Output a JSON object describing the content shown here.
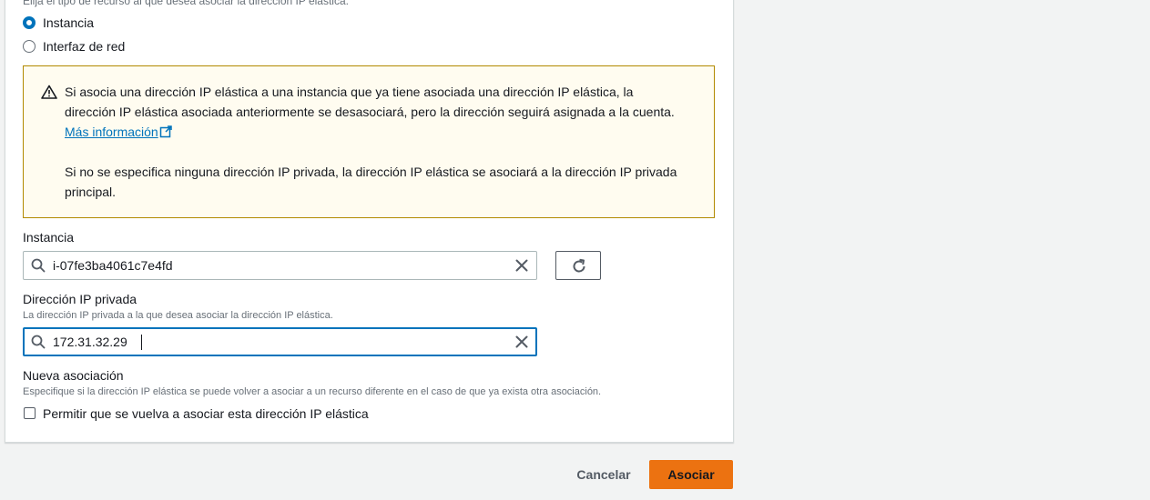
{
  "resource_type": {
    "description": "Elija el tipo de recurso al que desea asociar la dirección IP elástica.",
    "options": [
      {
        "label": "Instancia",
        "checked": true
      },
      {
        "label": "Interfaz de red",
        "checked": false
      }
    ]
  },
  "alert": {
    "line1": "Si asocia una dirección IP elástica a una instancia que ya tiene asociada una dirección IP elástica, la",
    "line2": "dirección IP elástica asociada anteriormente se desasociará, pero la dirección seguirá asignada a la cuenta.",
    "link": "Más información",
    "line3": "Si no se especifica ninguna dirección IP privada, la dirección IP elástica se asociará a la dirección IP privada",
    "line4": "principal."
  },
  "instance": {
    "label": "Instancia",
    "value": "i-07fe3ba4061c7e4fd"
  },
  "private_ip": {
    "label": "Dirección IP privada",
    "description": "La dirección IP privada a la que desea asociar la dirección IP elástica.",
    "value": "172.31.32.29"
  },
  "reassociation": {
    "label": "Nueva asociación",
    "description": "Especifique si la dirección IP elástica se puede volver a asociar a un recurso diferente en el caso de que ya exista otra asociación.",
    "checkbox_label": "Permitir que se vuelva a asociar esta dirección IP elástica",
    "checked": false
  },
  "footer": {
    "cancel_label": "Cancelar",
    "submit_label": "Asociar"
  },
  "colors": {
    "accent": "#0073bb",
    "primary_button": "#ec7211",
    "alert_bg": "#fffcf0",
    "alert_border": "#b28a00"
  }
}
